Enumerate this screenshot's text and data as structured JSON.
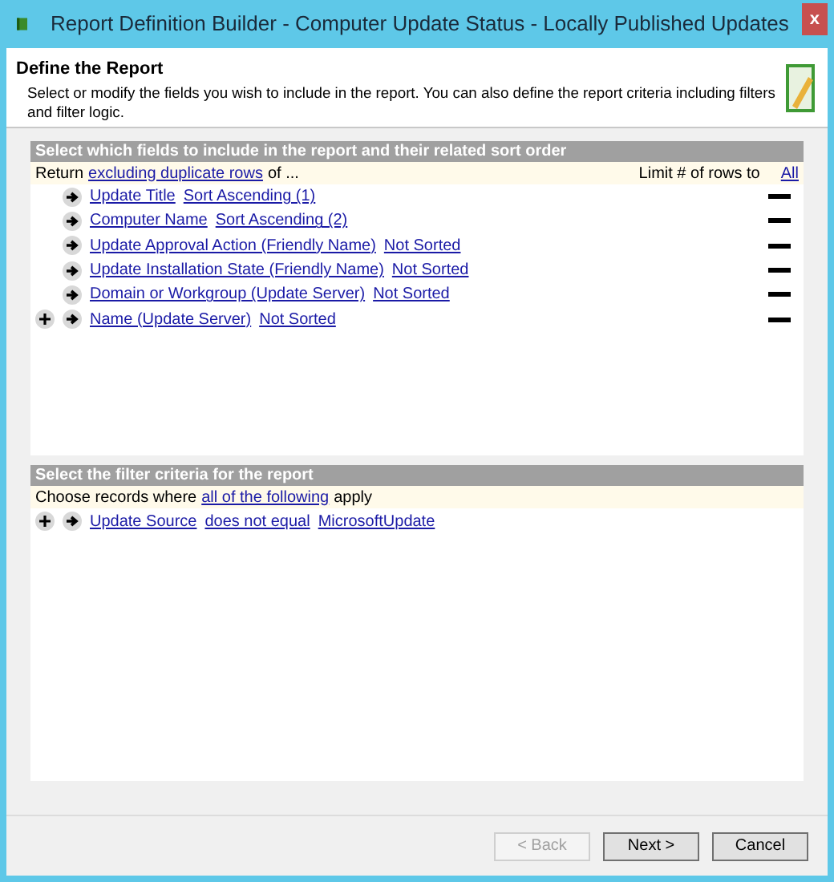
{
  "window": {
    "title": "Report Definition Builder - Computer Update Status - Locally Published Updates",
    "close": "x"
  },
  "header": {
    "title": "Define the Report",
    "description": "Select or modify the fields you wish to include in the report. You can also define the report criteria including filters and filter logic."
  },
  "fields_panel": {
    "title": "Select which fields to include in the report and their related sort order",
    "return_prefix": "Return",
    "return_link": "excluding duplicate rows",
    "return_suffix": "of ...",
    "limit_label": "Limit # of rows to",
    "limit_link": "All",
    "rows": [
      {
        "field": "Update Title",
        "sort": "Sort Ascending (1)",
        "add_button": false
      },
      {
        "field": "Computer Name",
        "sort": "Sort Ascending (2)",
        "add_button": false
      },
      {
        "field": "Update Approval Action (Friendly Name)",
        "sort": "Not Sorted",
        "add_button": false
      },
      {
        "field": "Update Installation State (Friendly Name)",
        "sort": "Not Sorted",
        "add_button": false
      },
      {
        "field": "Domain or Workgroup (Update Server)",
        "sort": "Not Sorted",
        "add_button": false
      },
      {
        "field": "Name (Update Server)",
        "sort": "Not Sorted",
        "add_button": true
      }
    ]
  },
  "filter_panel": {
    "title": "Select the filter criteria for the report",
    "prefix": "Choose records where",
    "link": "all of the following",
    "suffix": "apply",
    "rows": [
      {
        "field": "Update Source",
        "operator": "does not equal",
        "value": "MicrosoftUpdate",
        "add_button": true
      }
    ]
  },
  "buttons": [
    {
      "label": "< Back",
      "disabled": true
    },
    {
      "label": "Next >",
      "disabled": false
    },
    {
      "label": "Cancel",
      "disabled": false
    }
  ]
}
